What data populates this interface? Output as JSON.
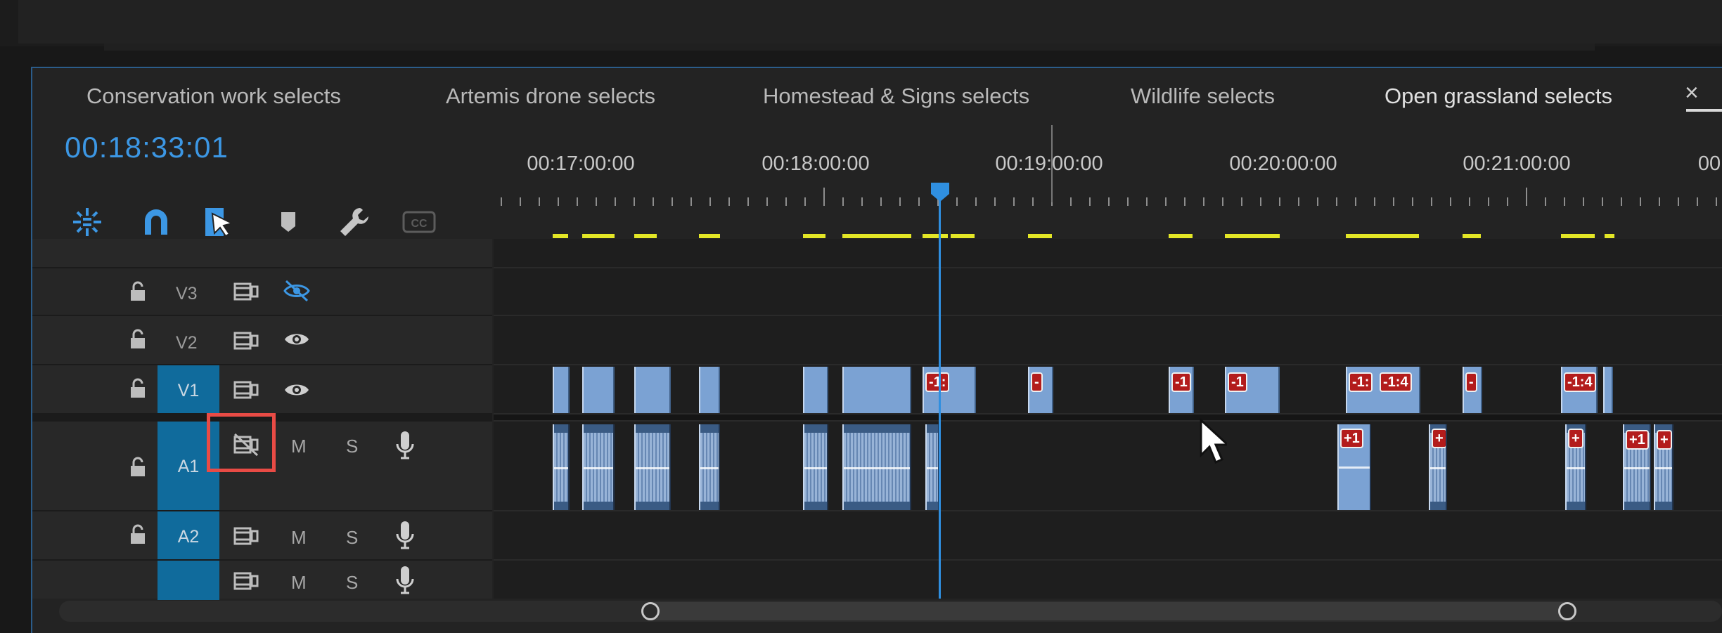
{
  "tabs": [
    {
      "label": "Conservation work selects"
    },
    {
      "label": "Artemis drone selects"
    },
    {
      "label": "Homestead & Signs selects"
    },
    {
      "label": "Wildlife selects"
    },
    {
      "label": "Open grassland selects"
    }
  ],
  "close_glyph": "×",
  "timecode": "00:18:33:01",
  "ruler_labels": [
    "00:17:00:00",
    "00:18:00:00",
    "00:19:00:00",
    "00:20:00:00",
    "00:21:00:00",
    "00:"
  ],
  "toolbar": {
    "icons": [
      "insert-and-overwrite-sequences-as-nests-icon",
      "snap-magnet-icon",
      "linked-selection-icon",
      "add-marker-icon",
      "timeline-settings-wrench-icon",
      "captions-cc-icon"
    ],
    "cc_label": "CC"
  },
  "tracks": {
    "v3": {
      "label": "V3"
    },
    "v2": {
      "label": "V2"
    },
    "v1": {
      "label": "V1"
    },
    "a1": {
      "label": "A1",
      "mute": "M",
      "solo": "S"
    },
    "a2": {
      "label": "A2",
      "mute": "M",
      "solo": "S"
    },
    "a3": {
      "label": "",
      "mute": "M",
      "solo": "S"
    }
  },
  "badges": {
    "v1": [
      "-1:",
      "-",
      "-1",
      "-1",
      "-1:",
      "-1:4",
      "-",
      "-1:4"
    ],
    "a1": [
      "+1",
      "+",
      "+",
      "+1",
      "+"
    ]
  },
  "colors": {
    "accent": "#3c97e4",
    "track_target": "#106b9c",
    "render_bar": "#e3e626",
    "clip_video": "#7ba2d3",
    "badge": "#b31c1c",
    "highlight": "#e94b45"
  }
}
